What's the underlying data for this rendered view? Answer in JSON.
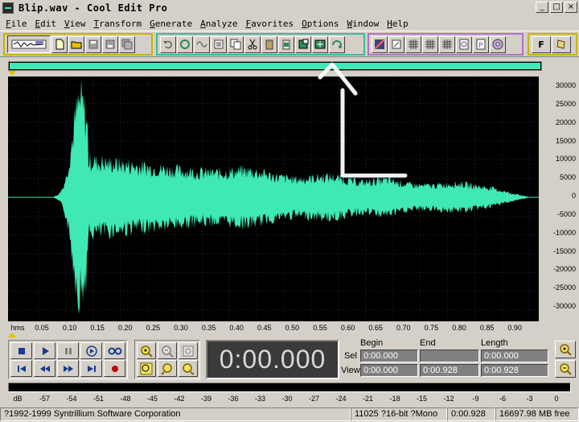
{
  "window": {
    "title": "Blip.wav - Cool Edit Pro"
  },
  "menu": [
    "File",
    "Edit",
    "View",
    "Transform",
    "Generate",
    "Analyze",
    "Favorites",
    "Options",
    "Window",
    "Help"
  ],
  "colors": {
    "waveform": "#3fe8b4",
    "accent_yellow": "#e8c000",
    "annotation": "#ffffff"
  },
  "waveform": {
    "y_ticks": [
      "30000",
      "25000",
      "20000",
      "15000",
      "10000",
      "5000",
      "0",
      "-5000",
      "-10000",
      "-15000",
      "-20000",
      "-25000",
      "-30000"
    ],
    "x_ticks": [
      "hms",
      "0.05",
      "0.10",
      "0.15",
      "0.20",
      "0.25",
      "0.30",
      "0.35",
      "0.40",
      "0.45",
      "0.50",
      "0.55",
      "0.60",
      "0.65",
      "0.70",
      "0.75",
      "0.80",
      "0.85",
      "0.90"
    ]
  },
  "transport": {
    "time": "0:00.000"
  },
  "selection": {
    "headers": [
      "Begin",
      "End",
      "Length"
    ],
    "sel_label": "Sel",
    "view_label": "View",
    "sel_begin": "0:00.000",
    "sel_end": "",
    "sel_length": "0:00.000",
    "view_begin": "0:00.000",
    "view_end": "0:00.928",
    "view_length": "0:00.928"
  },
  "meter": {
    "ticks": [
      "dB",
      "-57",
      "-54",
      "-51",
      "-48",
      "-45",
      "-42",
      "-39",
      "-36",
      "-33",
      "-30",
      "-27",
      "-24",
      "-21",
      "-18",
      "-15",
      "-12",
      "-9",
      "-6",
      "-3",
      "0"
    ]
  },
  "status": {
    "copyright": "?1992-1999 Syntrillium Software Corporation",
    "format": "11025 ?16-bit ?Mono",
    "duration": "0:00.928",
    "free": "16697.98 MB free"
  }
}
